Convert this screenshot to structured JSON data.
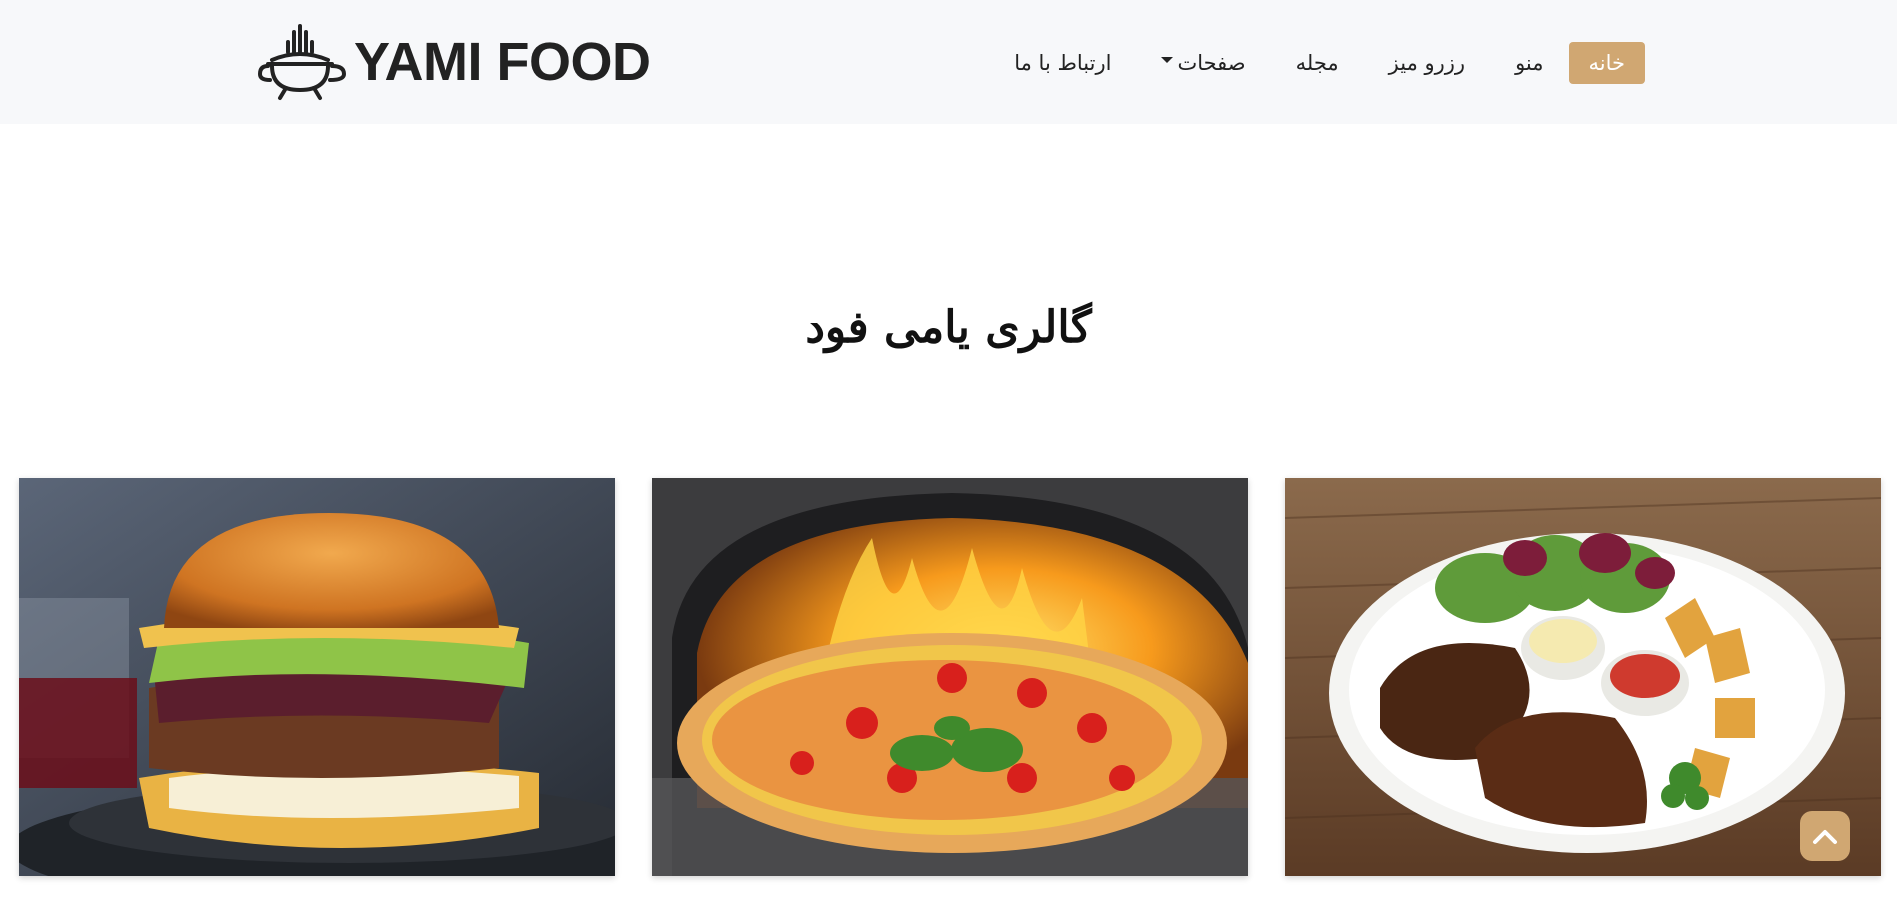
{
  "brand": {
    "name": "YAMI FOOD",
    "logo_icon": "grill-pot-icon"
  },
  "nav": {
    "items": [
      {
        "label": "خانه",
        "active": true
      },
      {
        "label": "منو"
      },
      {
        "label": "رزرو میز"
      },
      {
        "label": "مجله"
      },
      {
        "label": "صفحات",
        "dropdown": true
      },
      {
        "label": "ارتباط با ما"
      }
    ]
  },
  "gallery": {
    "title": "گالری یامی فود",
    "images": [
      {
        "subject": "burger"
      },
      {
        "subject": "pizza"
      },
      {
        "subject": "ribs-plate"
      }
    ]
  },
  "scroll_top": {
    "icon": "chevron-up-icon"
  },
  "colors": {
    "accent": "#d0a772",
    "navbar_bg": "#f7f8fa",
    "text": "#222222"
  }
}
